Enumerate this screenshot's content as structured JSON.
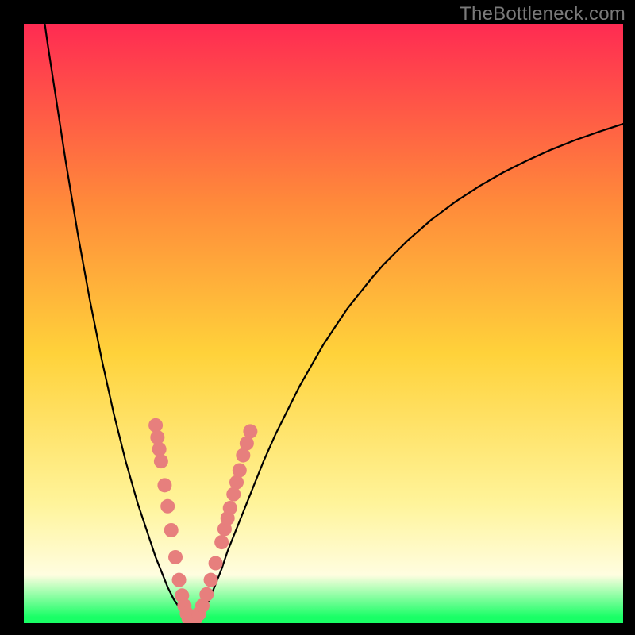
{
  "watermark": "TheBottleneck.com",
  "colors": {
    "frame": "#000000",
    "grad_top": "#ff2b52",
    "grad_mid_upper": "#ff8a3a",
    "grad_mid": "#ffd23a",
    "grad_lower": "#fff49a",
    "grad_pale": "#fffde0",
    "grad_green": "#19ff66",
    "curve": "#000000",
    "marker_fill": "#e77f7d",
    "marker_stroke": "#c96a6a"
  },
  "chart_data": {
    "type": "line",
    "title": "",
    "xlabel": "",
    "ylabel": "",
    "xlim": [
      0,
      100
    ],
    "ylim": [
      0,
      100
    ],
    "grid": false,
    "legend": false,
    "curve_x": [
      3.5,
      4,
      5,
      6,
      7,
      8,
      9,
      10,
      11,
      12,
      13,
      14,
      15,
      16,
      17,
      18,
      19,
      20,
      21,
      22,
      23,
      24,
      25,
      26,
      27,
      28,
      29,
      30,
      31,
      32,
      33,
      34,
      36,
      38,
      40,
      42,
      44,
      46,
      48,
      50,
      52,
      54,
      56,
      58,
      60,
      64,
      68,
      72,
      76,
      80,
      84,
      88,
      92,
      96,
      100
    ],
    "curve_y": [
      100,
      96.5,
      90,
      83.5,
      77,
      71,
      65,
      59.5,
      54,
      49,
      44,
      39.5,
      35,
      31,
      27,
      23.5,
      20,
      17,
      14,
      11,
      8.5,
      6,
      4,
      2.5,
      1.3,
      0.5,
      0.8,
      2,
      4,
      6.5,
      9,
      12,
      17,
      22,
      27,
      31.5,
      35.5,
      39.5,
      43,
      46.5,
      49.5,
      52.5,
      55,
      57.5,
      59.8,
      63.8,
      67.3,
      70.3,
      72.9,
      75.2,
      77.2,
      79,
      80.6,
      82,
      83.3
    ],
    "markers": [
      {
        "x": 22.0,
        "y": 33.0
      },
      {
        "x": 22.3,
        "y": 31.0
      },
      {
        "x": 22.6,
        "y": 29.0
      },
      {
        "x": 22.9,
        "y": 27.0
      },
      {
        "x": 23.5,
        "y": 23.0
      },
      {
        "x": 24.0,
        "y": 19.5
      },
      {
        "x": 24.6,
        "y": 15.5
      },
      {
        "x": 25.3,
        "y": 11.0
      },
      {
        "x": 25.9,
        "y": 7.2
      },
      {
        "x": 26.4,
        "y": 4.6
      },
      {
        "x": 26.8,
        "y": 2.9
      },
      {
        "x": 27.2,
        "y": 1.6
      },
      {
        "x": 27.5,
        "y": 0.8
      },
      {
        "x": 28.0,
        "y": 0.4
      },
      {
        "x": 28.6,
        "y": 0.7
      },
      {
        "x": 29.2,
        "y": 1.5
      },
      {
        "x": 29.8,
        "y": 2.9
      },
      {
        "x": 30.5,
        "y": 4.8
      },
      {
        "x": 31.2,
        "y": 7.2
      },
      {
        "x": 32.0,
        "y": 10.0
      },
      {
        "x": 33.0,
        "y": 13.5
      },
      {
        "x": 33.5,
        "y": 15.7
      },
      {
        "x": 34.0,
        "y": 17.5
      },
      {
        "x": 34.4,
        "y": 19.2
      },
      {
        "x": 35.0,
        "y": 21.5
      },
      {
        "x": 35.5,
        "y": 23.5
      },
      {
        "x": 36.0,
        "y": 25.5
      },
      {
        "x": 36.6,
        "y": 28.0
      },
      {
        "x": 37.2,
        "y": 30.0
      },
      {
        "x": 37.8,
        "y": 32.0
      }
    ],
    "marker_radius_px": 9
  }
}
